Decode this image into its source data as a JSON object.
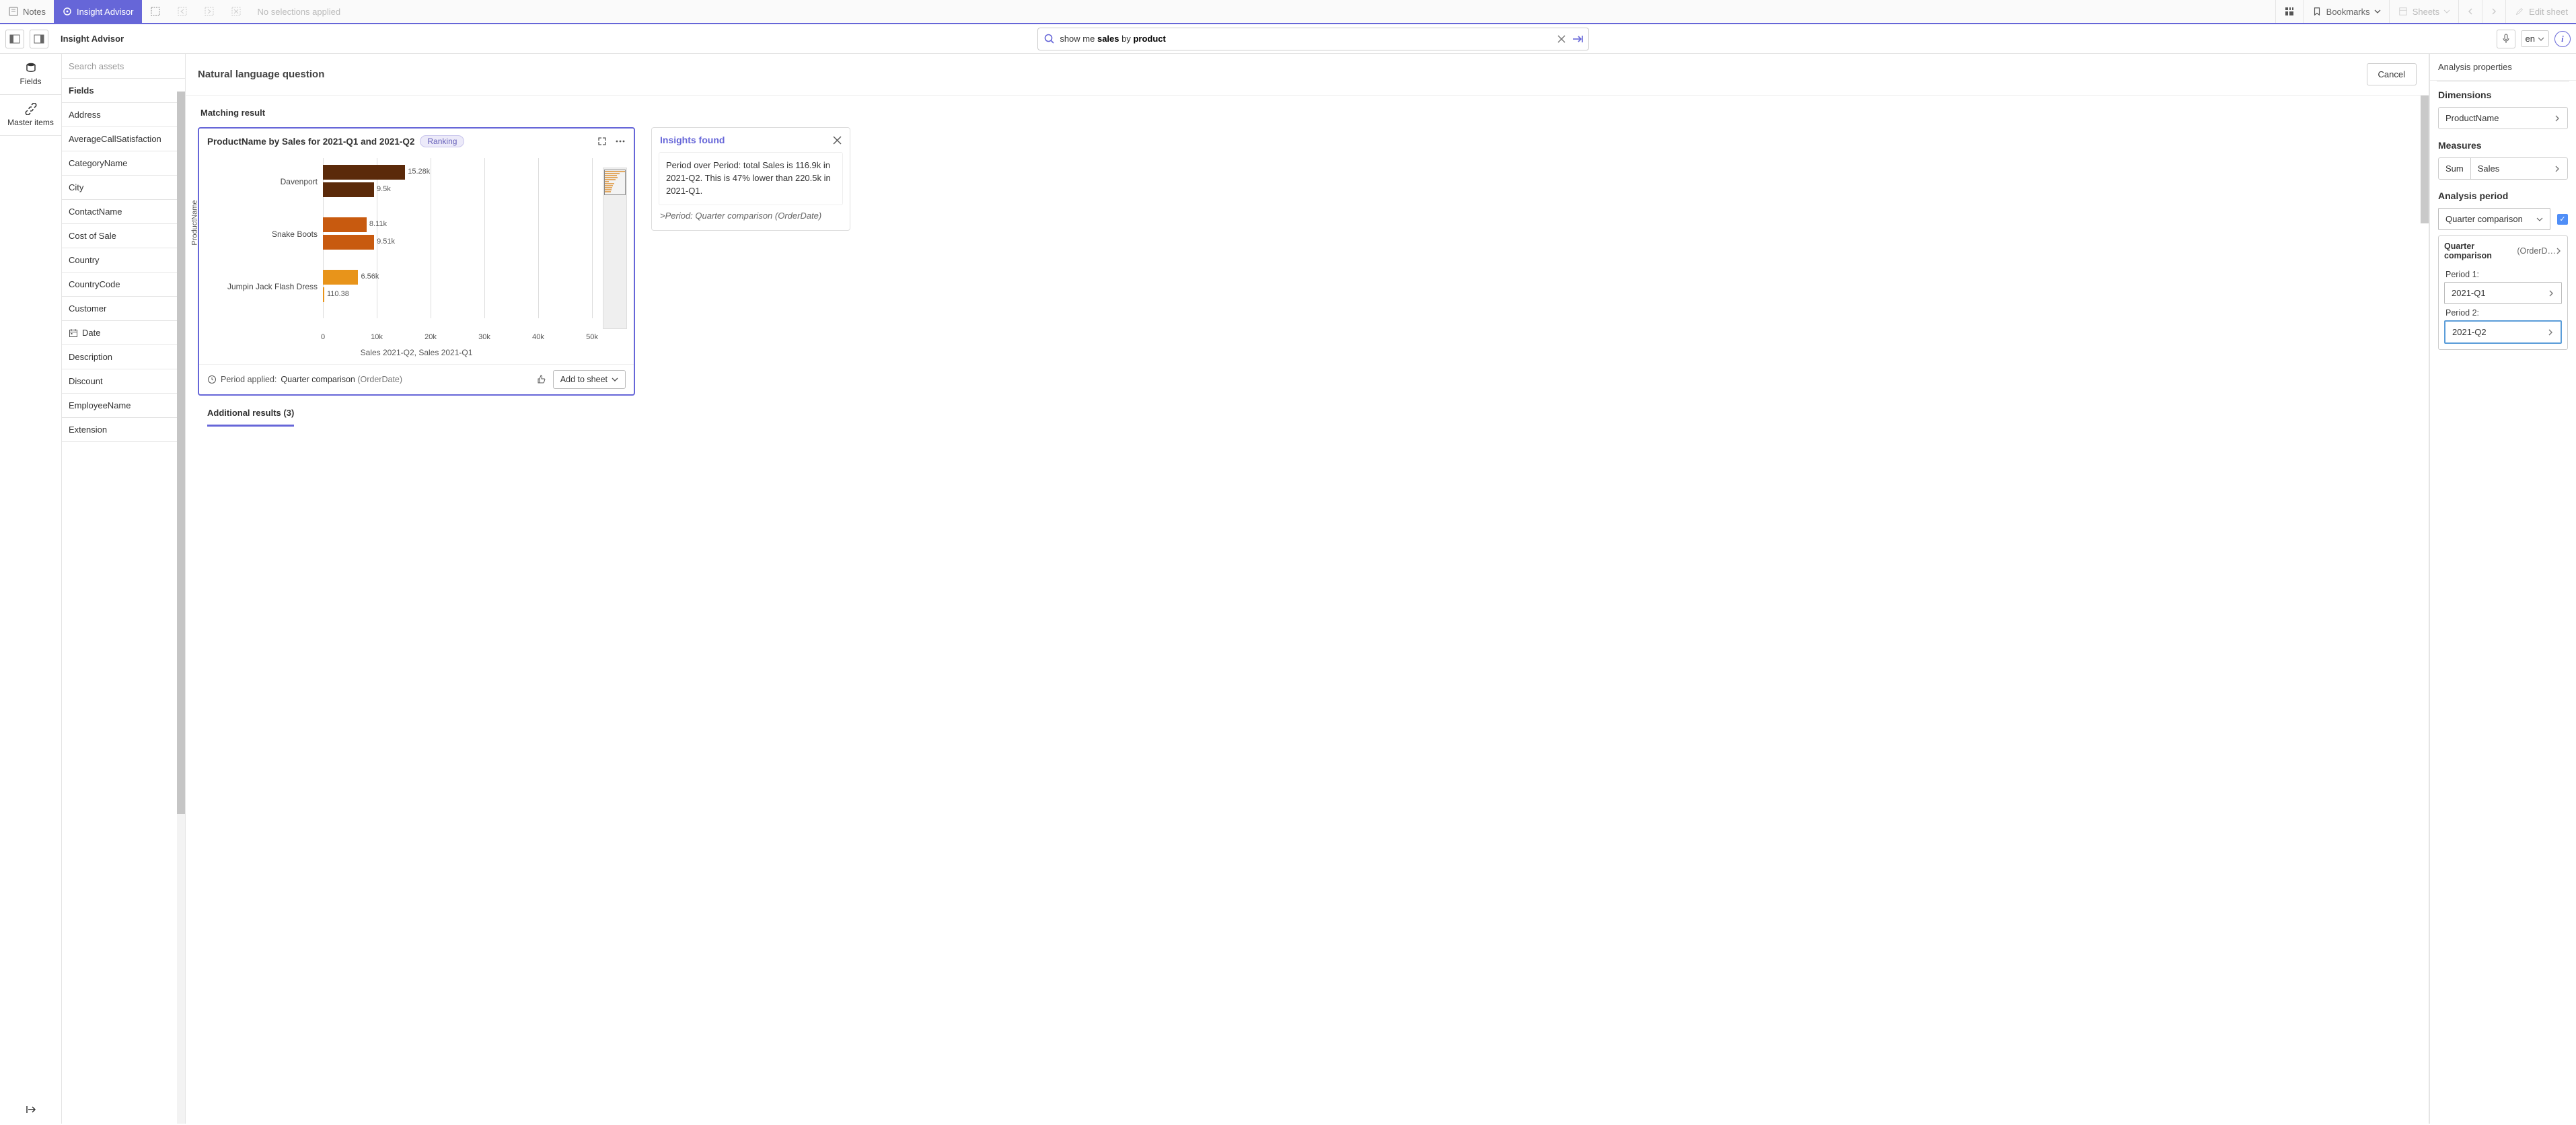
{
  "topbar": {
    "notes": "Notes",
    "insight": "Insight Advisor",
    "no_selections": "No selections applied",
    "bookmarks": "Bookmarks",
    "sheets": "Sheets",
    "edit_sheet": "Edit sheet"
  },
  "secondbar": {
    "title": "Insight Advisor",
    "search_prefix": "show me ",
    "search_b1": "sales",
    "search_mid": " by ",
    "search_b2": "product",
    "lang": "en"
  },
  "leftnav": {
    "fields": "Fields",
    "master": "Master items"
  },
  "fields": {
    "search_placeholder": "Search assets",
    "header": "Fields",
    "items": [
      "Address",
      "AverageCallSatisfaction",
      "CategoryName",
      "City",
      "ContactName",
      "Cost of Sale",
      "Country",
      "CountryCode",
      "Customer",
      "Date",
      "Description",
      "Discount",
      "EmployeeName",
      "Extension"
    ]
  },
  "center": {
    "nlq": "Natural language question",
    "cancel": "Cancel",
    "matching": "Matching result",
    "additional": "Additional results (3)"
  },
  "chartcard": {
    "title": "ProductName by Sales for 2021-Q1 and 2021-Q2",
    "badge": "Ranking",
    "ylabel": "ProductName",
    "xaxis_label": "Sales 2021-Q2, Sales 2021-Q1",
    "period_applied_label": "Period applied:",
    "period_applied_value": "Quarter comparison",
    "period_applied_suffix": "(OrderDate)",
    "add_to_sheet": "Add to sheet"
  },
  "chart_data": {
    "type": "bar",
    "orientation": "horizontal",
    "title": "ProductName by Sales for 2021-Q1 and 2021-Q2",
    "ylabel": "ProductName",
    "xlabel": "Sales 2021-Q2, Sales 2021-Q1",
    "xlim": [
      0,
      50000
    ],
    "xticks": [
      0,
      10000,
      20000,
      30000,
      40000,
      50000
    ],
    "xtick_labels": [
      "0",
      "10k",
      "20k",
      "30k",
      "40k",
      "50k"
    ],
    "categories": [
      "Davenport",
      "Snake Boots",
      "Jumpin Jack Flash Dress"
    ],
    "series": [
      {
        "name": "Sales 2021-Q1",
        "values": [
          15280,
          8110,
          6560
        ],
        "labels": [
          "15.28k",
          "8.11k",
          "6.56k"
        ],
        "colors": [
          "#5b2a0a",
          "#c85a0f",
          "#e8941a"
        ]
      },
      {
        "name": "Sales 2021-Q2",
        "values": [
          9500,
          9510,
          110.38
        ],
        "labels": [
          "9.5k",
          "9.51k",
          "110.38"
        ],
        "colors": [
          "#5b2a0a",
          "#c85a0f",
          "#e8941a"
        ]
      }
    ]
  },
  "insights": {
    "title": "Insights found",
    "body": "Period over Period: total Sales is 116.9k in 2021-Q2. This is 47% lower than 220.5k in 2021-Q1.",
    "note": ">Period: Quarter comparison (OrderDate)"
  },
  "right": {
    "title": "Analysis properties",
    "dimensions": "Dimensions",
    "dimension_value": "ProductName",
    "measures": "Measures",
    "agg": "Sum",
    "measure_value": "Sales",
    "analysis_period": "Analysis period",
    "period_type": "Quarter comparison",
    "period_detail_prefix": "Quarter comparison",
    "period_detail_suffix": " (OrderD…",
    "p1_label": "Period 1:",
    "p1_value": "2021-Q1",
    "p2_label": "Period 2:",
    "p2_value": "2021-Q2"
  }
}
